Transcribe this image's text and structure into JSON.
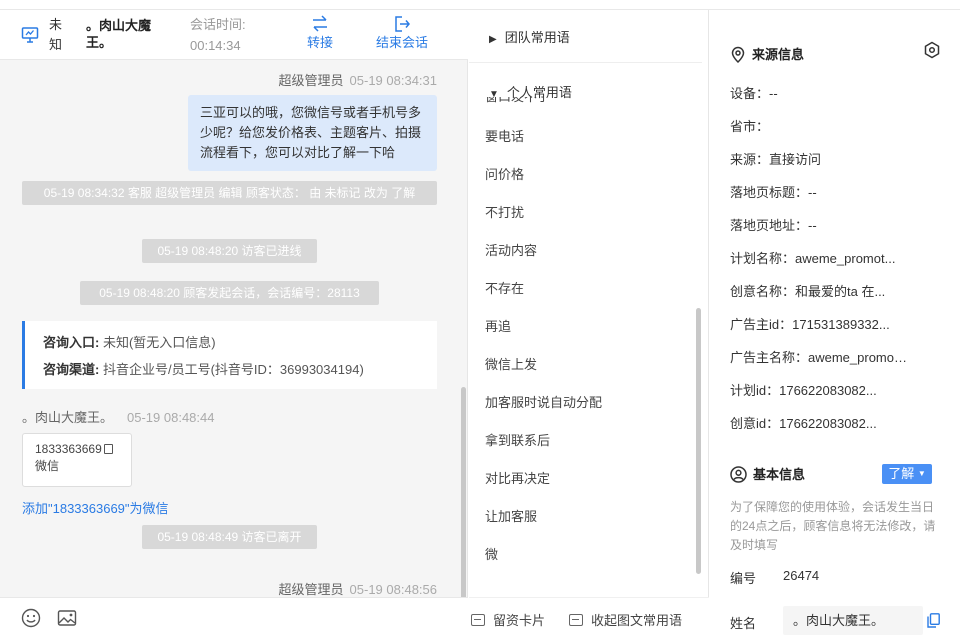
{
  "header": {
    "status": "未知",
    "visitor_name": "。肉山大魔王。",
    "session_label": "会话时间:",
    "session_time": "00:14:34",
    "transfer_label": "转接",
    "end_label": "结束会话"
  },
  "chat": {
    "msg1_sender": "超级管理员",
    "msg1_time": "05-19 08:34:31",
    "msg1_text": "三亚可以的哦，您微信号或者手机号多少呢？给您发价格表、主题客片、拍摄流程看下，您可以对比了解一下哈",
    "sys1": "05-19 08:34:32 客服 超级管理员 编辑 顾客状态： 由 未标记 改为 了解",
    "sys2": "05-19 08:48:20 访客已进线",
    "sys3": "05-19 08:48:20 顾客发起会话，会话编号：28113",
    "entry_label": "咨询入口:",
    "entry_value": "未知(暂无入口信息)",
    "channel_label": "咨询渠道:",
    "channel_value": "抖音企业号/员工号(抖音号ID：36993034194)",
    "visitor_sender": "。肉山大魔王。",
    "visitor_time": "05-19 08:48:44",
    "phone": "1833363669",
    "phone_type": "微信",
    "add_wechat": "添加\"1833363669\"为微信",
    "sys4": "05-19 08:48:49 访客已离开",
    "msg2_sender": "超级管理员",
    "msg2_time": "05-19 08:48:56"
  },
  "phrases": {
    "team_group": "团队常用语",
    "personal_group": "个人常用语",
    "partial_item": "窗口发不了",
    "items": [
      "要电话",
      "问价格",
      "不打扰",
      "活动内容",
      "不存在",
      "再追",
      "微信上发",
      "加客服时说自动分配",
      "拿到联系后",
      "对比再决定",
      "让加客服",
      "微"
    ],
    "card_btn": "留资卡片",
    "collapse_btn": "收起图文常用语"
  },
  "info": {
    "source_title": "来源信息",
    "fields": [
      "设备：--",
      "省市：",
      "来源：直接访问",
      "落地页标题：--",
      "落地页地址：--",
      "计划名称：aweme_promot...",
      "创意名称：和最爱的ta 在...",
      "广告主id：171531389332...",
      "广告主名称：aweme_promot...",
      "计划id：176622083082...",
      "创意id：176622083082..."
    ],
    "basic_title": "基本信息",
    "know_label": "了解",
    "note": "为了保障您的使用体验，会话发生当日的24点之后，顾客信息将无法修改，请及时填写",
    "id_label": "编号",
    "id_value": "26474",
    "name_label": "姓名",
    "name_value": "。肉山大魔王。"
  },
  "colors": {
    "accent": "#2a7be4",
    "bubble": "#dce9fb",
    "system": "#d8d8d8"
  }
}
